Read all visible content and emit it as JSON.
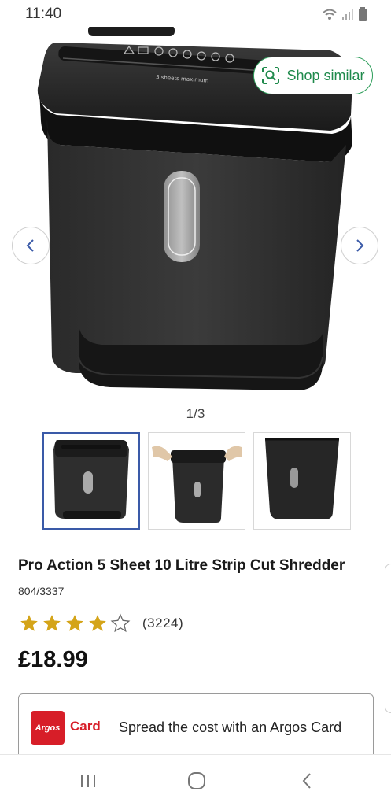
{
  "status_bar": {
    "time": "11:40",
    "icons": [
      "wifi-icon",
      "signal-icon",
      "battery-icon"
    ]
  },
  "gallery": {
    "shop_similar_label": "Shop similar",
    "counter": "1/3",
    "thumbnails": [
      "shredder-front",
      "shredder-with-hands",
      "shredder-bin"
    ],
    "active_thumbnail": 0,
    "slot_label": "5 sheets maximum"
  },
  "product": {
    "title": "Pro Action 5 Sheet 10 Litre Strip Cut Shredder",
    "sku": "804/3337",
    "rating_value": 4,
    "rating_max": 5,
    "review_count": "(3224)",
    "price": "£18.99"
  },
  "argos_card": {
    "logo_text": "Argos",
    "card_word": "Card",
    "text": "Spread the cost with an Argos Card"
  },
  "colors": {
    "accent_green": "#2e9e5a",
    "star_gold": "#d4a419",
    "argos_red": "#d71e28",
    "active_thumb_border": "#3a5aa8"
  }
}
